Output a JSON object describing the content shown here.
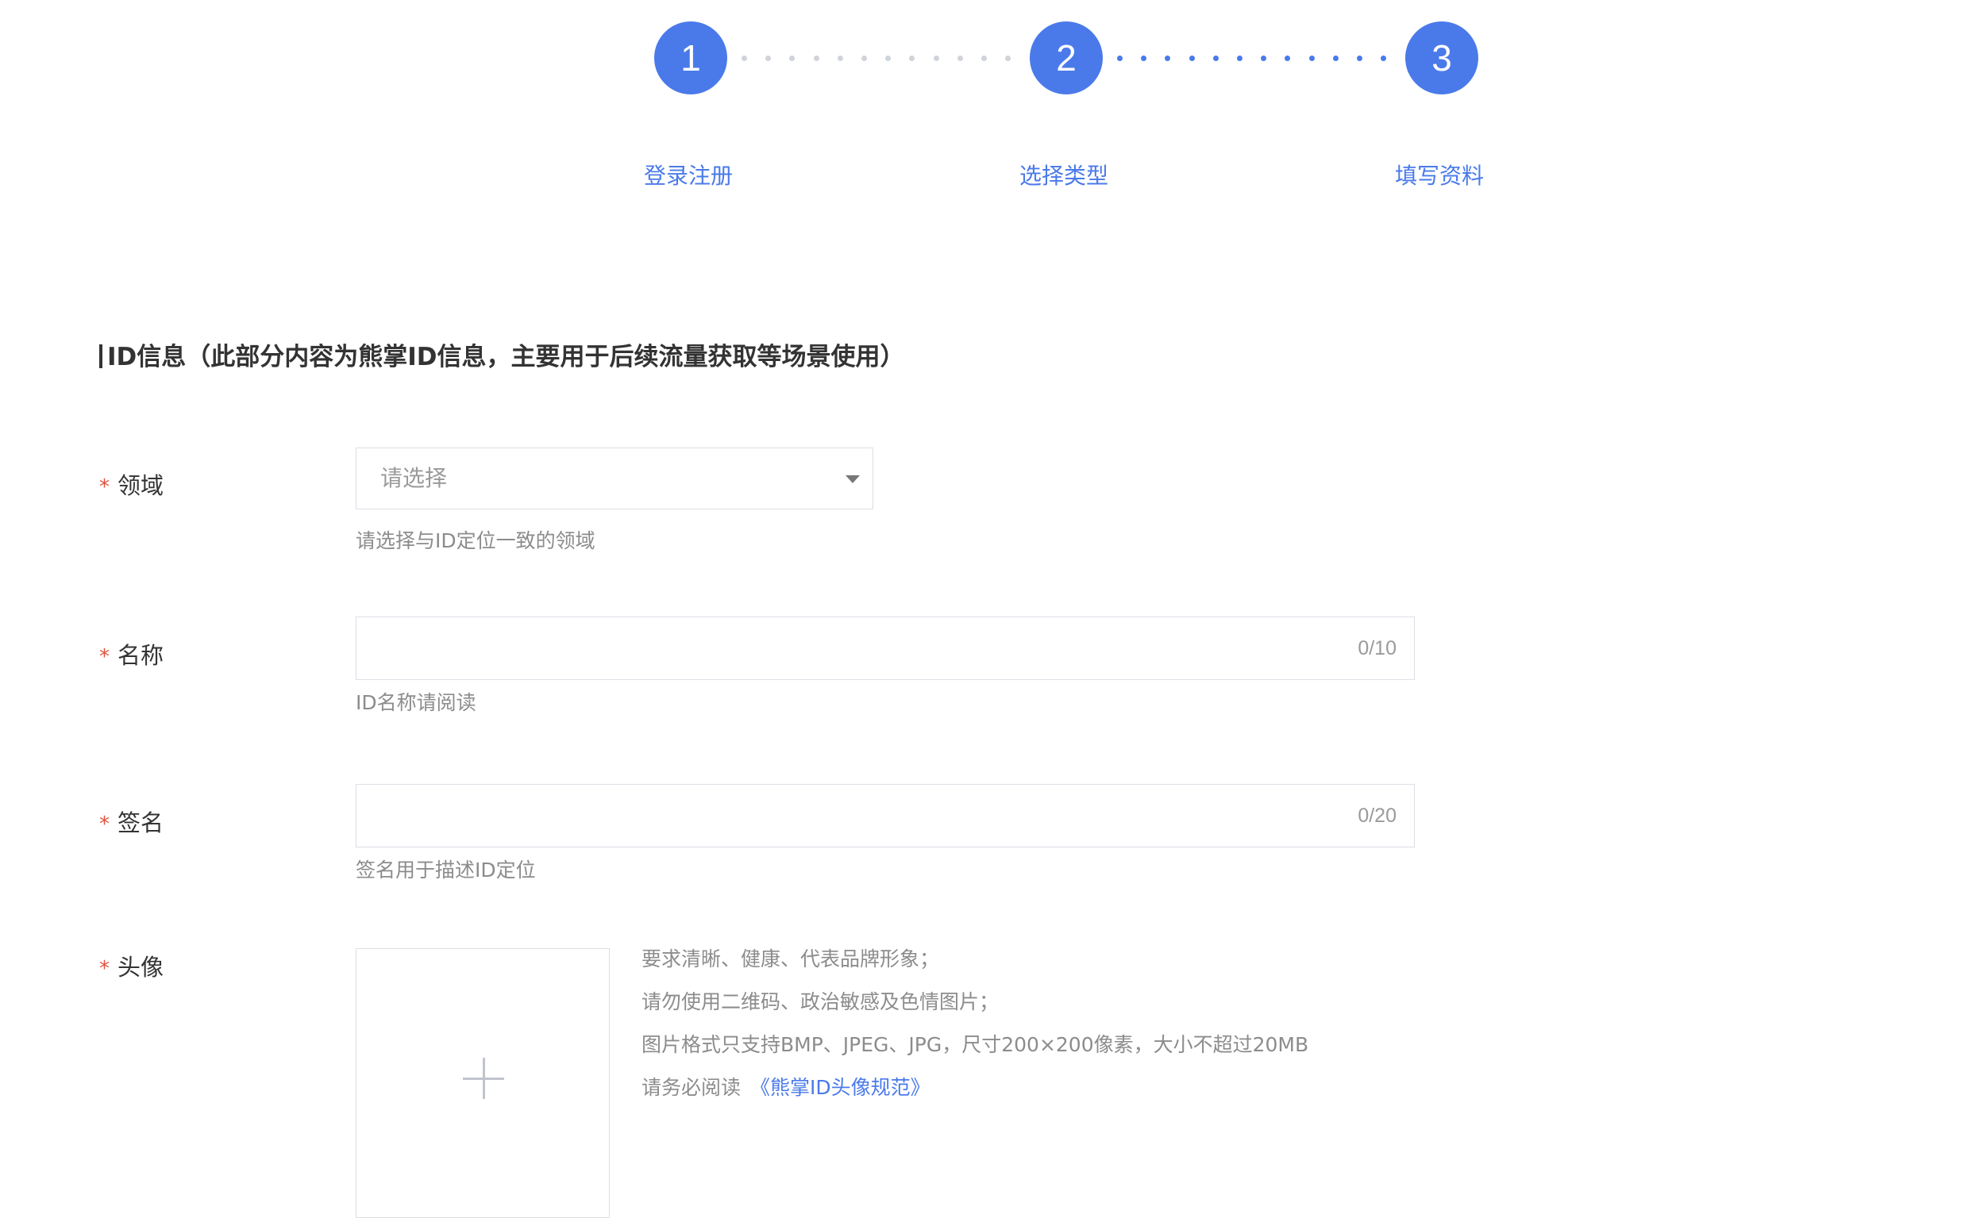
{
  "steps": [
    {
      "number": "1",
      "label": "登录注册"
    },
    {
      "number": "2",
      "label": "选择类型"
    },
    {
      "number": "3",
      "label": "填写资料"
    }
  ],
  "colors": {
    "primary": "#4a7aea",
    "required_mark": "#e0523e",
    "pending_dot": "#cfd3da"
  },
  "section": {
    "title": "ID信息（此部分内容为熊掌ID信息，主要用于后续流量获取等场景使用）"
  },
  "form": {
    "required_mark": "*",
    "domain": {
      "label": "领域",
      "placeholder": "请选择",
      "hint": "请选择与ID定位一致的领域",
      "icon": "chevron-down-icon"
    },
    "name": {
      "label": "名称",
      "value": "",
      "counter": "0/10",
      "hint": "ID名称请阅读"
    },
    "signature": {
      "label": "签名",
      "value": "",
      "counter": "0/20",
      "hint": "签名用于描述ID定位"
    },
    "avatar": {
      "label": "头像",
      "upload_icon": "plus-icon",
      "requirements": [
        "要求清晰、健康、代表品牌形象；",
        "请勿使用二维码、政治敏感及色情图片；",
        "图片格式只支持BMP、JPEG、JPG，尺寸200×200像素，大小不超过20MB"
      ],
      "read_prefix": "请务必阅读",
      "read_link": "《熊掌ID头像规范》"
    }
  }
}
